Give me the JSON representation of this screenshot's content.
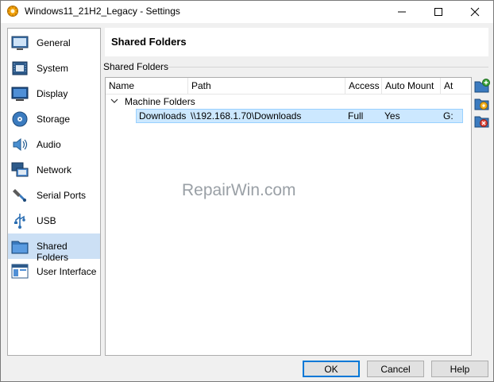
{
  "window": {
    "title": "Windows11_21H2_Legacy - Settings",
    "controls": {
      "minimize": "—",
      "maximize": "☐",
      "close": "✕"
    }
  },
  "sidebar": {
    "items": [
      {
        "label": "General",
        "icon": "general-icon"
      },
      {
        "label": "System",
        "icon": "system-icon"
      },
      {
        "label": "Display",
        "icon": "display-icon"
      },
      {
        "label": "Storage",
        "icon": "storage-icon"
      },
      {
        "label": "Audio",
        "icon": "audio-icon"
      },
      {
        "label": "Network",
        "icon": "network-icon"
      },
      {
        "label": "Serial Ports",
        "icon": "serial-ports-icon"
      },
      {
        "label": "USB",
        "icon": "usb-icon"
      },
      {
        "label": "Shared Folders",
        "icon": "shared-folders-icon",
        "selected": true
      },
      {
        "label": "User Interface",
        "icon": "user-interface-icon"
      }
    ]
  },
  "page": {
    "title": "Shared Folders",
    "group_label": "Shared Folders"
  },
  "table": {
    "columns": [
      "Name",
      "Path",
      "Access",
      "Auto Mount",
      "At"
    ],
    "group": "Machine Folders",
    "rows": [
      {
        "name": "Downloads",
        "path": "\\\\192.168.1.70\\Downloads",
        "access": "Full",
        "auto_mount": "Yes",
        "at": "G:"
      }
    ]
  },
  "toolbar": {
    "icons": [
      "add-folder-icon",
      "edit-folder-icon",
      "remove-folder-icon"
    ]
  },
  "watermark": "RepairWin.com",
  "buttons": {
    "ok": "OK",
    "cancel": "Cancel",
    "help": "Help"
  },
  "colors": {
    "selection": "#cce8ff",
    "accent": "#0078d7",
    "sidebar_selected": "#cce0f5"
  }
}
